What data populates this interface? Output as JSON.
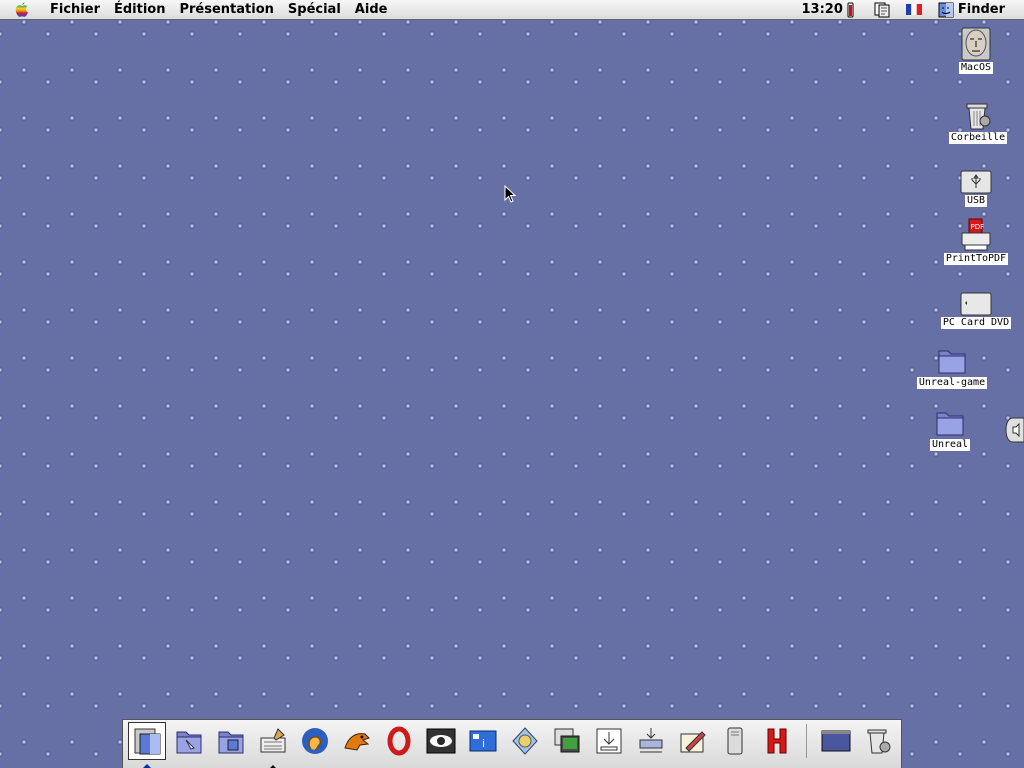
{
  "menubar": {
    "items": [
      "Fichier",
      "Édition",
      "Présentation",
      "Spécial",
      "Aide"
    ],
    "clock": "13:20",
    "app_name": "Finder"
  },
  "desktop_icons": [
    {
      "label": "MacOS",
      "icon": "hard-disk-face-icon"
    },
    {
      "label": "Corbeille",
      "icon": "trash-icon"
    },
    {
      "label": "USB",
      "icon": "usb-drive-icon"
    },
    {
      "label": "PrintToPDF",
      "icon": "pdf-printer-icon"
    },
    {
      "label": "PC Card DVD",
      "icon": "pc-card-icon"
    },
    {
      "label": "Unreal-game",
      "icon": "folder-icon"
    },
    {
      "label": "Unreal",
      "icon": "folder-icon"
    }
  ],
  "launcher": {
    "items": [
      {
        "icon": "finder-icon"
      },
      {
        "icon": "documents-folder-icon"
      },
      {
        "icon": "system-folder-icon"
      },
      {
        "icon": "keyboard-stylus-app-icon"
      },
      {
        "icon": "ear-sound-app-icon"
      },
      {
        "icon": "dinosaur-app-icon"
      },
      {
        "icon": "opera-icon"
      },
      {
        "icon": "eye-preview-icon"
      },
      {
        "icon": "info-window-icon"
      },
      {
        "icon": "network-globe-icon"
      },
      {
        "icon": "virtual-pc-icon"
      },
      {
        "icon": "download-tray-icon"
      },
      {
        "icon": "network-transfer-icon"
      },
      {
        "icon": "drawing-app-icon"
      },
      {
        "icon": "tower-computer-icon"
      },
      {
        "icon": "red-h-app-icon"
      },
      {
        "icon": "window-app-icon"
      },
      {
        "icon": "trash-icon"
      }
    ]
  },
  "colors": {
    "desktop": "#6670a4",
    "menubar": "#dcdcdc",
    "folder": "#8a92d8"
  }
}
